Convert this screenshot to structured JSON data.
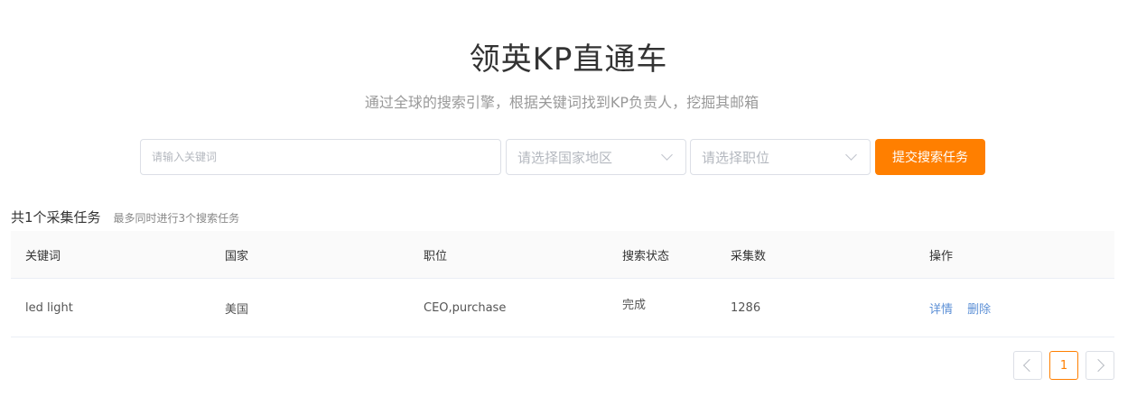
{
  "header": {
    "title": "领英KP直通车",
    "subtitle": "通过全球的搜索引擎，根据关键词找到KP负责人，挖掘其邮箱"
  },
  "search": {
    "keyword_placeholder": "请输入关键词",
    "keyword_value": "",
    "country_placeholder": "请选择国家地区",
    "position_placeholder": "请选择职位",
    "submit_label": "提交搜索任务"
  },
  "summary": {
    "count_text": "共1个采集任务",
    "note_text": "最多同时进行3个搜索任务"
  },
  "table": {
    "headers": [
      "关键词",
      "国家",
      "职位",
      "搜索状态",
      "采集数",
      "操作"
    ],
    "rows": [
      {
        "keyword": "led light",
        "country": "美国",
        "position": "CEO,purchase",
        "status": "完成",
        "count": "1286",
        "actions": [
          "详情",
          "删除"
        ]
      }
    ]
  },
  "pagination": {
    "current_page": "1",
    "prev_icon": "chevron-left-icon",
    "next_icon": "chevron-right-icon"
  },
  "colors": {
    "accent": "#ff7f00",
    "link": "#5b8fd6"
  }
}
